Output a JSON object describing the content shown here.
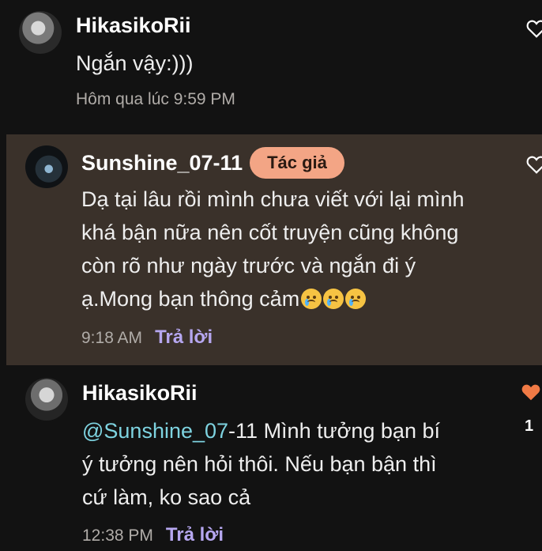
{
  "comments": [
    {
      "author": "HikasikoRii",
      "text": "Ngắn vậy:)))",
      "time": "Hôm qua lúc 9:59 PM",
      "liked": false
    },
    {
      "author": "Sunshine_07-11",
      "badge": "Tác giả",
      "text": "Dạ tại lâu rồi mình chưa viết với lại mình khá bận nữa nên cốt truyện cũng không còn rõ như ngày trước và ngắn đi ý ạ.Mong bạn thông cảm",
      "emojis": [
        "sad-tear-emoji",
        "sad-tear-emoji",
        "sad-tear-emoji"
      ],
      "time": "9:18 AM",
      "reply_label": "Trả lời",
      "liked": false
    },
    {
      "author": "HikasikoRii",
      "mention": "@Sunshine_07",
      "text": "-11 Mình tưởng bạn bí ý tưởng nên hỏi thôi. Nếu bạn bận thì cứ làm, ko sao cả",
      "time": "12:38 PM",
      "reply_label": "Trả lời",
      "liked": true,
      "like_count": "1"
    }
  ],
  "icons": {
    "heart_outline": "heart-outline-icon",
    "heart_filled": "heart-filled-icon"
  },
  "colors": {
    "background": "#121212",
    "author_highlight_bg": "#3a312a",
    "badge_bg": "#f3a585",
    "reply_link": "#b6a7f0",
    "mention": "#7ed3e0",
    "heart_liked": "#f07a45"
  }
}
